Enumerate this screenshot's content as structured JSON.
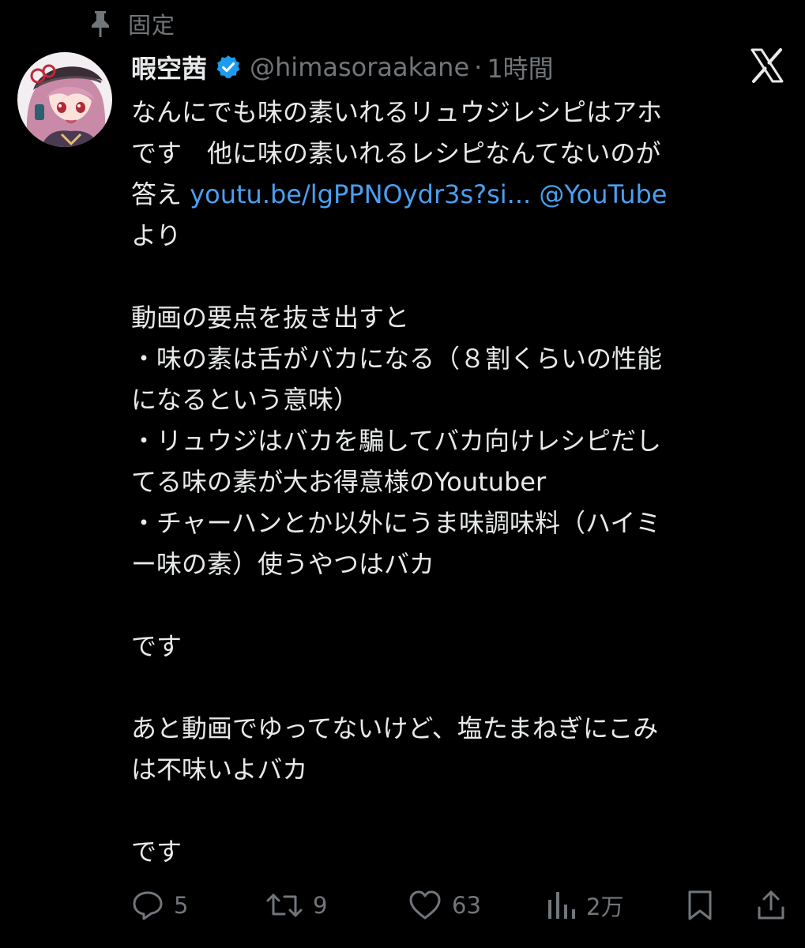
{
  "pinned": {
    "label": "固定",
    "icon": "pin-icon"
  },
  "author": {
    "display_name": "暇空茜",
    "verified": true,
    "handle": "@himasoraakane",
    "separator": "·",
    "time": "1時間"
  },
  "tweet": {
    "line1": "なんにでも味の素いれるリュウジレシピはアホ",
    "line2": "です　他に味の素いれるレシピなんてないのが",
    "line3_prefix": "答え ",
    "link_url": "youtu.be/lgPPNOydr3s?si...",
    "link_mention": "@YouTube",
    "line4": "より",
    "line5": "",
    "line6": "動画の要点を抜き出すと",
    "line7": "・味の素は舌がバカになる（８割くらいの性能",
    "line8": "になるという意味）",
    "line9": "・リュウジはバカを騙してバカ向けレシピだし",
    "line10": "てる味の素が大お得意様のYoutuber",
    "line11": "・チャーハンとか以外にうま味調味料（ハイミ",
    "line12": "ー味の素）使うやつはバカ",
    "line13": "",
    "line14": "です",
    "line15": "",
    "line16": "あと動画でゆってないけど、塩たまねぎにこみ",
    "line17": "は不味いよバカ",
    "line18": "",
    "line19": "です"
  },
  "actions": {
    "reply_count": "5",
    "retweet_count": "9",
    "like_count": "63",
    "view_count": "2万"
  },
  "colors": {
    "background": "#000000",
    "text": "#e7e9ea",
    "secondary": "#71767b",
    "link": "#4a9ff0",
    "verified": "#1d9bf0"
  }
}
